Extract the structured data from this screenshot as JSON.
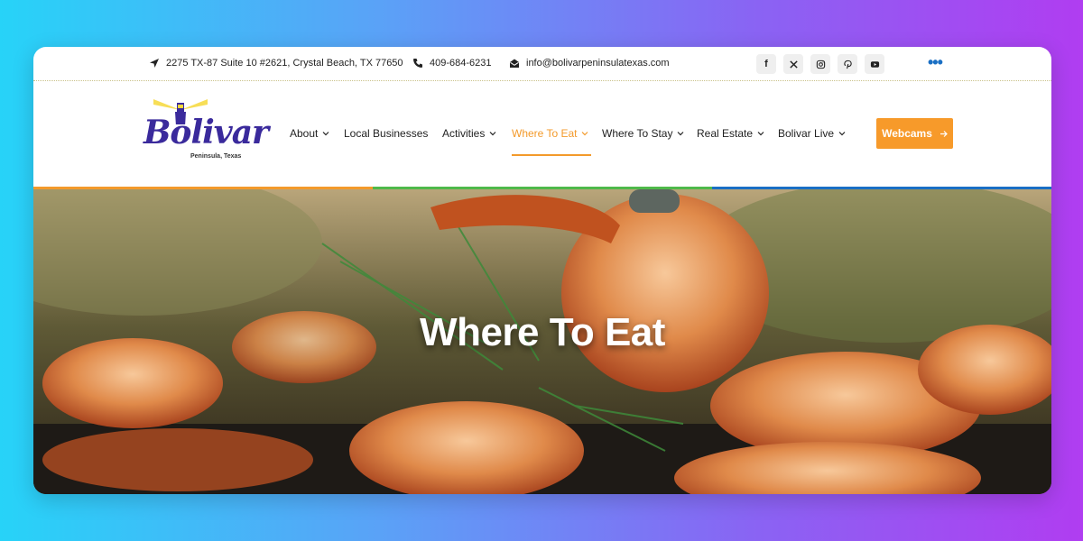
{
  "topbar": {
    "address": "2275 TX-87 Suite 10 #2621, Crystal Beach, TX 77650",
    "phone": "409-684-6231",
    "email": "info@bolivarpeninsulatexas.com",
    "social": [
      "facebook",
      "x",
      "instagram",
      "pinterest",
      "youtube"
    ],
    "more_icon": "ellipsis-icon"
  },
  "logo": {
    "name": "Bolivar",
    "tagline": "Peninsula, Texas"
  },
  "nav": {
    "items": [
      {
        "label": "About",
        "has_dropdown": true
      },
      {
        "label": "Local Businesses",
        "has_dropdown": false
      },
      {
        "label": "Activities",
        "has_dropdown": true
      },
      {
        "label": "Where To Eat",
        "has_dropdown": true,
        "active": true
      },
      {
        "label": "Where To Stay",
        "has_dropdown": true
      },
      {
        "label": "Real Estate",
        "has_dropdown": true
      },
      {
        "label": "Bolivar Live",
        "has_dropdown": true
      }
    ],
    "cta_label": "Webcams"
  },
  "colors": {
    "accent": "#f39a2b",
    "stripe": [
      "#f39a2b",
      "#4fb94a",
      "#1a6fc4"
    ],
    "logo": "#3a2a9c"
  },
  "hero": {
    "title": "Where To Eat"
  }
}
